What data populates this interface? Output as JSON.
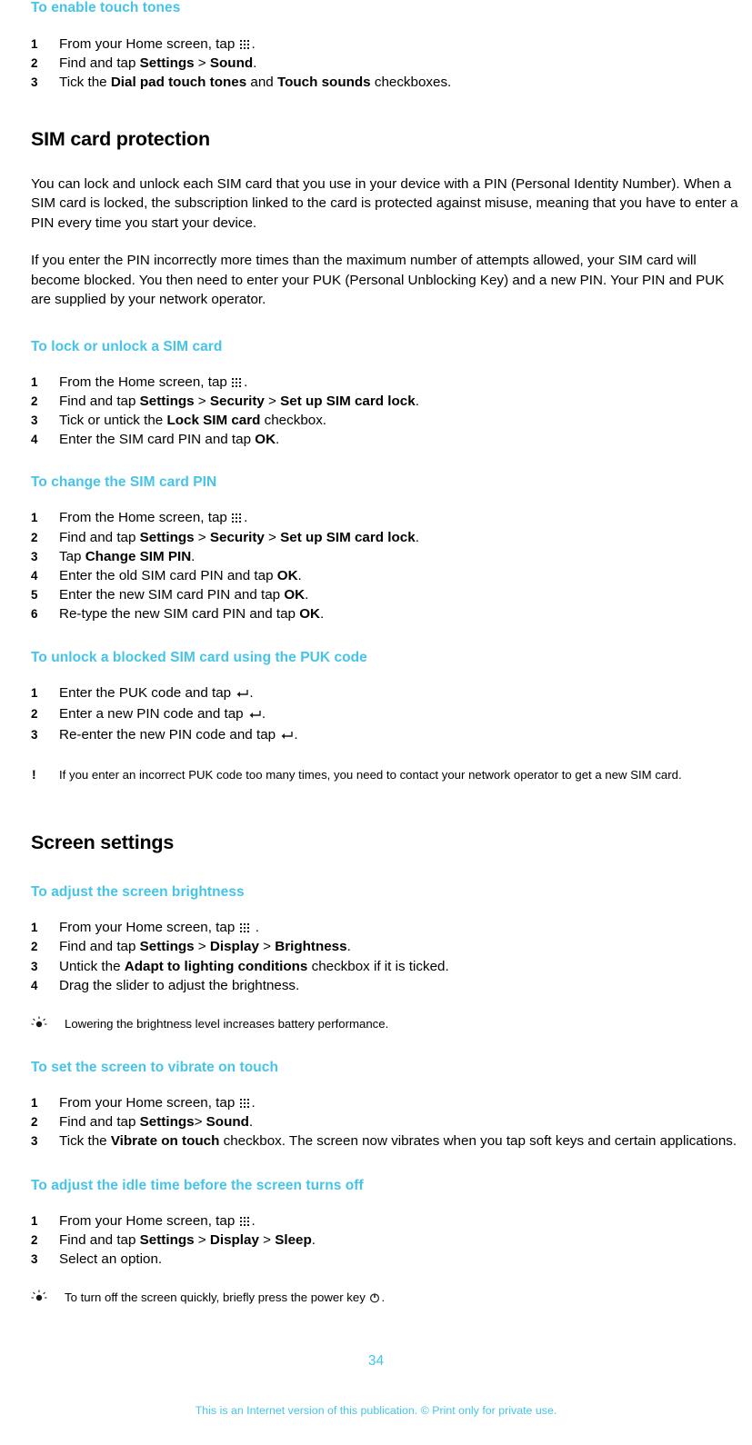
{
  "page": {
    "number": "34",
    "footer": "This is an Internet version of this publication. © Print only for private use."
  },
  "icons": {
    "app_grid": "app-grid-icon",
    "enter_key": "enter-key-icon",
    "power_key": "power-key-icon",
    "note_marker": "!",
    "tip_marker": "tip-bulb-icon"
  },
  "blocks": {
    "touch_tones": {
      "title": "To enable touch tones",
      "steps": [
        {
          "num": "1",
          "pre": "From your Home screen, tap ",
          "icon": "app_grid",
          "post": "."
        },
        {
          "num": "2",
          "parts": [
            {
              "t": "Find and tap ",
              "b": false
            },
            {
              "t": "Settings",
              "b": true
            },
            {
              "t": " > ",
              "b": false
            },
            {
              "t": "Sound",
              "b": true
            },
            {
              "t": ".",
              "b": false
            }
          ]
        },
        {
          "num": "3",
          "parts": [
            {
              "t": "Tick the ",
              "b": false
            },
            {
              "t": "Dial pad touch tones",
              "b": true
            },
            {
              "t": " and ",
              "b": false
            },
            {
              "t": "Touch sounds",
              "b": true
            },
            {
              "t": " checkboxes.",
              "b": false
            }
          ]
        }
      ]
    },
    "sim_card_protection": {
      "title": "SIM card protection",
      "paragraphs": [
        "You can lock and unlock each SIM card that you use in your device with a PIN (Personal Identity Number). When a SIM card is locked, the subscription linked to the card is protected against misuse, meaning that you have to enter a PIN every time you start your device.",
        "If you enter the PIN incorrectly more times than the maximum number of attempts allowed, your SIM card will become blocked. You then need to enter your PUK (Personal Unblocking Key) and a new PIN. Your PIN and PUK are supplied by your network operator."
      ]
    },
    "lock_unlock_sim": {
      "title": "To lock or unlock a SIM card",
      "steps": [
        {
          "num": "1",
          "pre": "From the Home screen, tap ",
          "icon": "app_grid",
          "post": "."
        },
        {
          "num": "2",
          "parts": [
            {
              "t": "Find and tap ",
              "b": false
            },
            {
              "t": "Settings",
              "b": true
            },
            {
              "t": " > ",
              "b": false
            },
            {
              "t": "Security",
              "b": true
            },
            {
              "t": " > ",
              "b": false
            },
            {
              "t": "Set up SIM card lock",
              "b": true
            },
            {
              "t": ".",
              "b": false
            }
          ]
        },
        {
          "num": "3",
          "parts": [
            {
              "t": "Tick or untick the ",
              "b": false
            },
            {
              "t": "Lock SIM card",
              "b": true
            },
            {
              "t": " checkbox.",
              "b": false
            }
          ]
        },
        {
          "num": "4",
          "parts": [
            {
              "t": "Enter the SIM card PIN and tap ",
              "b": false
            },
            {
              "t": "OK",
              "b": true
            },
            {
              "t": ".",
              "b": false
            }
          ]
        }
      ]
    },
    "change_sim_pin": {
      "title": "To change the SIM card PIN",
      "steps": [
        {
          "num": "1",
          "pre": "From the Home screen, tap ",
          "icon": "app_grid",
          "post": "."
        },
        {
          "num": "2",
          "parts": [
            {
              "t": "Find and tap ",
              "b": false
            },
            {
              "t": "Settings",
              "b": true
            },
            {
              "t": " > ",
              "b": false
            },
            {
              "t": "Security",
              "b": true
            },
            {
              "t": " > ",
              "b": false
            },
            {
              "t": "Set up SIM card lock",
              "b": true
            },
            {
              "t": ".",
              "b": false
            }
          ]
        },
        {
          "num": "3",
          "parts": [
            {
              "t": "Tap ",
              "b": false
            },
            {
              "t": "Change SIM PIN",
              "b": true
            },
            {
              "t": ".",
              "b": false
            }
          ]
        },
        {
          "num": "4",
          "parts": [
            {
              "t": "Enter the old SIM card PIN and tap ",
              "b": false
            },
            {
              "t": "OK",
              "b": true
            },
            {
              "t": ".",
              "b": false
            }
          ]
        },
        {
          "num": "5",
          "parts": [
            {
              "t": "Enter the new SIM card PIN and tap ",
              "b": false
            },
            {
              "t": "OK",
              "b": true
            },
            {
              "t": ".",
              "b": false
            }
          ]
        },
        {
          "num": "6",
          "parts": [
            {
              "t": "Re-type the new SIM card PIN and tap ",
              "b": false
            },
            {
              "t": "OK",
              "b": true
            },
            {
              "t": ".",
              "b": false
            }
          ]
        }
      ]
    },
    "unlock_blocked_sim": {
      "title": "To unlock a blocked SIM card using the PUK code",
      "steps": [
        {
          "num": "1",
          "pre": "Enter the PUK code and tap ",
          "icon": "enter_key",
          "post": "."
        },
        {
          "num": "2",
          "pre": "Enter a new PIN code and tap ",
          "icon": "enter_key",
          "post": "."
        },
        {
          "num": "3",
          "pre": "Re-enter the new PIN code and tap ",
          "icon": "enter_key",
          "post": "."
        }
      ],
      "note": "If you enter an incorrect PUK code too many times, you need to contact your network operator to get a new SIM card."
    },
    "screen_settings": {
      "title": "Screen settings"
    },
    "adjust_brightness": {
      "title": "To adjust the screen brightness",
      "steps": [
        {
          "num": "1",
          "pre": "From your Home screen, tap ",
          "icon": "app_grid",
          "post": " ."
        },
        {
          "num": "2",
          "parts": [
            {
              "t": "Find and tap ",
              "b": false
            },
            {
              "t": "Settings",
              "b": true
            },
            {
              "t": " > ",
              "b": false
            },
            {
              "t": "Display",
              "b": true
            },
            {
              "t": " > ",
              "b": false
            },
            {
              "t": "Brightness",
              "b": true
            },
            {
              "t": ".",
              "b": false
            }
          ]
        },
        {
          "num": "3",
          "parts": [
            {
              "t": "Untick the ",
              "b": false
            },
            {
              "t": "Adapt to lighting conditions",
              "b": true
            },
            {
              "t": " checkbox if it is ticked.",
              "b": false
            }
          ]
        },
        {
          "num": "4",
          "parts": [
            {
              "t": "Drag the slider to adjust the brightness.",
              "b": false
            }
          ]
        }
      ],
      "tip": "Lowering the brightness level increases battery performance."
    },
    "vibrate_on_touch": {
      "title": "To set the screen to vibrate on touch",
      "steps": [
        {
          "num": "1",
          "pre": "From your Home screen, tap ",
          "icon": "app_grid",
          "post": "."
        },
        {
          "num": "2",
          "parts": [
            {
              "t": "Find and tap ",
              "b": false
            },
            {
              "t": "Settings",
              "b": true
            },
            {
              "t": "> ",
              "b": false
            },
            {
              "t": "Sound",
              "b": true
            },
            {
              "t": ".",
              "b": false
            }
          ]
        },
        {
          "num": "3",
          "parts": [
            {
              "t": "Tick the ",
              "b": false
            },
            {
              "t": "Vibrate on touch",
              "b": true
            },
            {
              "t": " checkbox. The screen now vibrates when you tap soft keys and certain applications.",
              "b": false
            }
          ]
        }
      ]
    },
    "idle_time": {
      "title": "To adjust the idle time before the screen turns off",
      "steps": [
        {
          "num": "1",
          "pre": "From your Home screen, tap ",
          "icon": "app_grid",
          "post": "."
        },
        {
          "num": "2",
          "parts": [
            {
              "t": "Find and tap ",
              "b": false
            },
            {
              "t": "Settings",
              "b": true
            },
            {
              "t": " > ",
              "b": false
            },
            {
              "t": "Display",
              "b": true
            },
            {
              "t": " > ",
              "b": false
            },
            {
              "t": "Sleep",
              "b": true
            },
            {
              "t": ".",
              "b": false
            }
          ]
        },
        {
          "num": "3",
          "parts": [
            {
              "t": "Select an option.",
              "b": false
            }
          ]
        }
      ],
      "tip_pre": "To turn off the screen quickly, briefly press the power key ",
      "tip_post": "."
    }
  },
  "colors": {
    "accent": "#45c4e8",
    "text": "#000000",
    "background": "#ffffff"
  }
}
